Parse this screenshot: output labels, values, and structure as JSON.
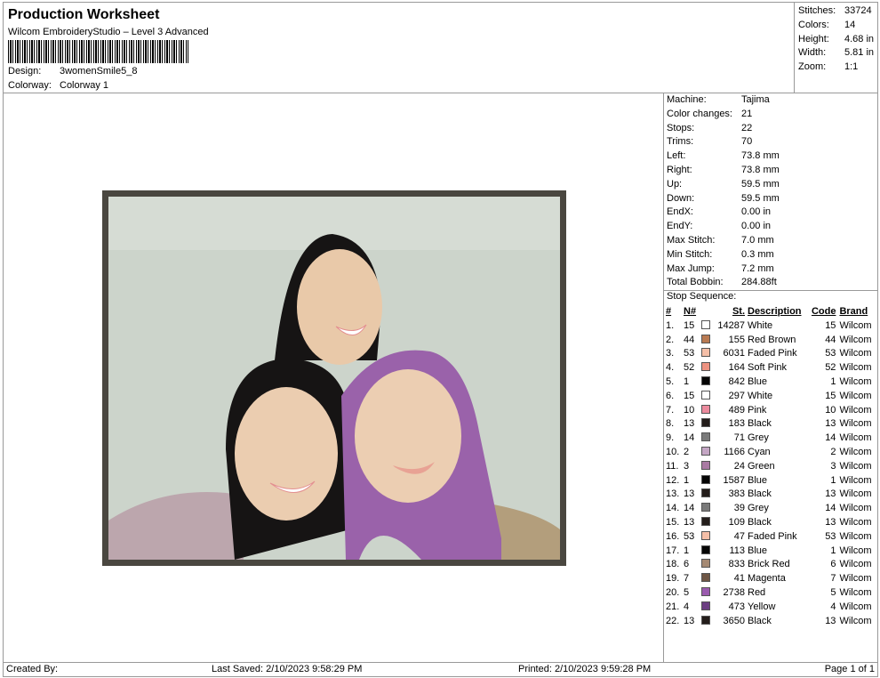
{
  "header": {
    "title": "Production Worksheet",
    "subtitle": "Wilcom EmbroideryStudio – Level 3 Advanced",
    "design_label": "Design:",
    "design": "3womenSmile5_8",
    "colorway_label": "Colorway:",
    "colorway": "Colorway 1"
  },
  "stats": [
    {
      "k": "Stitches:",
      "v": "33724"
    },
    {
      "k": "Colors:",
      "v": "14"
    },
    {
      "k": "Height:",
      "v": "4.68 in"
    },
    {
      "k": "Width:",
      "v": "5.81 in"
    },
    {
      "k": "Zoom:",
      "v": "1:1"
    }
  ],
  "machine": [
    {
      "k": "Machine:",
      "v": "Tajima"
    },
    {
      "k": "Color changes:",
      "v": "21"
    },
    {
      "k": "Stops:",
      "v": "22"
    },
    {
      "k": "Trims:",
      "v": "70"
    },
    {
      "k": "Left:",
      "v": "73.8 mm"
    },
    {
      "k": "Right:",
      "v": "73.8 mm"
    },
    {
      "k": "Up:",
      "v": "59.5 mm"
    },
    {
      "k": "Down:",
      "v": "59.5 mm"
    },
    {
      "k": "EndX:",
      "v": "0.00 in"
    },
    {
      "k": "EndY:",
      "v": "0.00 in"
    },
    {
      "k": "Max Stitch:",
      "v": "7.0 mm"
    },
    {
      "k": "Min Stitch:",
      "v": "0.3 mm"
    },
    {
      "k": "Max Jump:",
      "v": "7.2 mm"
    },
    {
      "k": "Total Bobbin:",
      "v": "284.88ft"
    }
  ],
  "stop_sequence_label": "Stop Sequence:",
  "columns": [
    "#",
    "N#",
    "St.",
    "Description",
    "Code",
    "Brand"
  ],
  "stops": [
    {
      "n": "1.",
      "nn": "15",
      "c": "#ffffff",
      "st": "14287",
      "d": "White",
      "code": "15",
      "b": "Wilcom"
    },
    {
      "n": "2.",
      "nn": "44",
      "c": "#b97a52",
      "st": "155",
      "d": "Red Brown",
      "code": "44",
      "b": "Wilcom"
    },
    {
      "n": "3.",
      "nn": "53",
      "c": "#f5bfa8",
      "st": "6031",
      "d": "Faded Pink",
      "code": "53",
      "b": "Wilcom"
    },
    {
      "n": "4.",
      "nn": "52",
      "c": "#ee9382",
      "st": "164",
      "d": "Soft Pink",
      "code": "52",
      "b": "Wilcom"
    },
    {
      "n": "5.",
      "nn": "1",
      "c": "#050505",
      "st": "842",
      "d": "Blue",
      "code": "1",
      "b": "Wilcom"
    },
    {
      "n": "6.",
      "nn": "15",
      "c": "#ffffff",
      "st": "297",
      "d": "White",
      "code": "15",
      "b": "Wilcom"
    },
    {
      "n": "7.",
      "nn": "10",
      "c": "#ec8b9e",
      "st": "489",
      "d": "Pink",
      "code": "10",
      "b": "Wilcom"
    },
    {
      "n": "8.",
      "nn": "13",
      "c": "#231d1a",
      "st": "183",
      "d": "Black",
      "code": "13",
      "b": "Wilcom"
    },
    {
      "n": "9.",
      "nn": "14",
      "c": "#7a7a7a",
      "st": "71",
      "d": "Grey",
      "code": "14",
      "b": "Wilcom"
    },
    {
      "n": "10.",
      "nn": "2",
      "c": "#c4a6c4",
      "st": "1166",
      "d": "Cyan",
      "code": "2",
      "b": "Wilcom"
    },
    {
      "n": "11.",
      "nn": "3",
      "c": "#a97aa3",
      "st": "24",
      "d": "Green",
      "code": "3",
      "b": "Wilcom"
    },
    {
      "n": "12.",
      "nn": "1",
      "c": "#050505",
      "st": "1587",
      "d": "Blue",
      "code": "1",
      "b": "Wilcom"
    },
    {
      "n": "13.",
      "nn": "13",
      "c": "#231d1a",
      "st": "383",
      "d": "Black",
      "code": "13",
      "b": "Wilcom"
    },
    {
      "n": "14.",
      "nn": "14",
      "c": "#7a7a7a",
      "st": "39",
      "d": "Grey",
      "code": "14",
      "b": "Wilcom"
    },
    {
      "n": "15.",
      "nn": "13",
      "c": "#231d1a",
      "st": "109",
      "d": "Black",
      "code": "13",
      "b": "Wilcom"
    },
    {
      "n": "16.",
      "nn": "53",
      "c": "#f5bfa8",
      "st": "47",
      "d": "Faded Pink",
      "code": "53",
      "b": "Wilcom"
    },
    {
      "n": "17.",
      "nn": "1",
      "c": "#050505",
      "st": "113",
      "d": "Blue",
      "code": "1",
      "b": "Wilcom"
    },
    {
      "n": "18.",
      "nn": "6",
      "c": "#a58a74",
      "st": "833",
      "d": "Brick Red",
      "code": "6",
      "b": "Wilcom"
    },
    {
      "n": "19.",
      "nn": "7",
      "c": "#6e5645",
      "st": "41",
      "d": "Magenta",
      "code": "7",
      "b": "Wilcom"
    },
    {
      "n": "20.",
      "nn": "5",
      "c": "#9a5aae",
      "st": "2738",
      "d": "Red",
      "code": "5",
      "b": "Wilcom"
    },
    {
      "n": "21.",
      "nn": "4",
      "c": "#6c3f82",
      "st": "473",
      "d": "Yellow",
      "code": "4",
      "b": "Wilcom"
    },
    {
      "n": "22.",
      "nn": "13",
      "c": "#231d1a",
      "st": "3650",
      "d": "Black",
      "code": "13",
      "b": "Wilcom"
    }
  ],
  "footer": {
    "created": "Created By:",
    "saved": "Last Saved: 2/10/2023 9:58:29 PM",
    "printed": "Printed: 2/10/2023 9:59:28 PM",
    "page": "Page 1 of 1"
  }
}
